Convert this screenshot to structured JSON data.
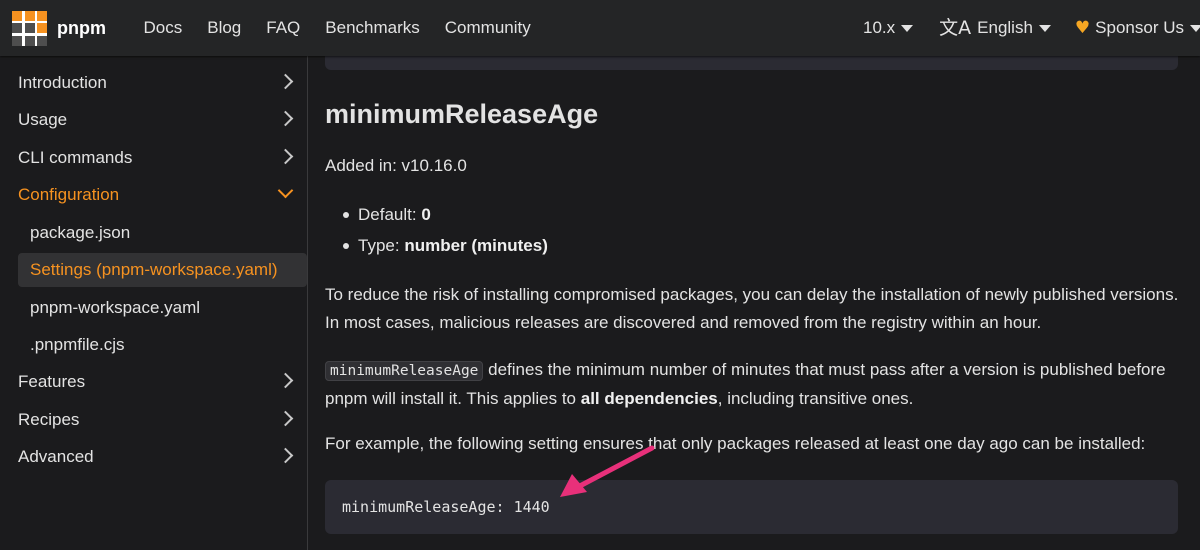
{
  "navbar": {
    "brand": "pnpm",
    "links": [
      "Docs",
      "Blog",
      "FAQ",
      "Benchmarks",
      "Community"
    ],
    "version": "10.x",
    "language": "English",
    "sponsor": "Sponsor Us",
    "logo_colors": [
      "#f69220",
      "#4e4e4e",
      "#ffffff"
    ]
  },
  "sidebar": {
    "items": [
      {
        "label": "Introduction"
      },
      {
        "label": "Usage"
      },
      {
        "label": "CLI commands"
      },
      {
        "label": "Configuration"
      },
      {
        "label": "package.json"
      },
      {
        "label": "Settings (pnpm-workspace.yaml)"
      },
      {
        "label": "pnpm-workspace.yaml"
      },
      {
        "label": ".pnpmfile.cjs"
      },
      {
        "label": "Features"
      },
      {
        "label": "Recipes"
      },
      {
        "label": "Advanced"
      }
    ],
    "accent_color": "#f69220"
  },
  "content": {
    "heading": "minimumReleaseAge",
    "added_in": "Added in: v10.16.0",
    "default_label": "Default: ",
    "default_value": "0",
    "type_label": "Type: ",
    "type_value": "number (minutes)",
    "para1": "To reduce the risk of installing compromised packages, you can delay the installation of newly published versions. In most cases, malicious releases are discovered and removed from the registry within an hour.",
    "para2_code": "minimumReleaseAge",
    "para2_a": " defines the minimum number of minutes that must pass after a version is published before pnpm will install it. This applies to ",
    "para2_bold": "all dependencies",
    "para2_b": ", including transitive ones.",
    "para3": "For example, the following setting ensures that only packages released at least one day ago can be installed:",
    "code_example": "minimumReleaseAge: 1440"
  },
  "annotation": {
    "arrow_color": "#e8307a"
  }
}
